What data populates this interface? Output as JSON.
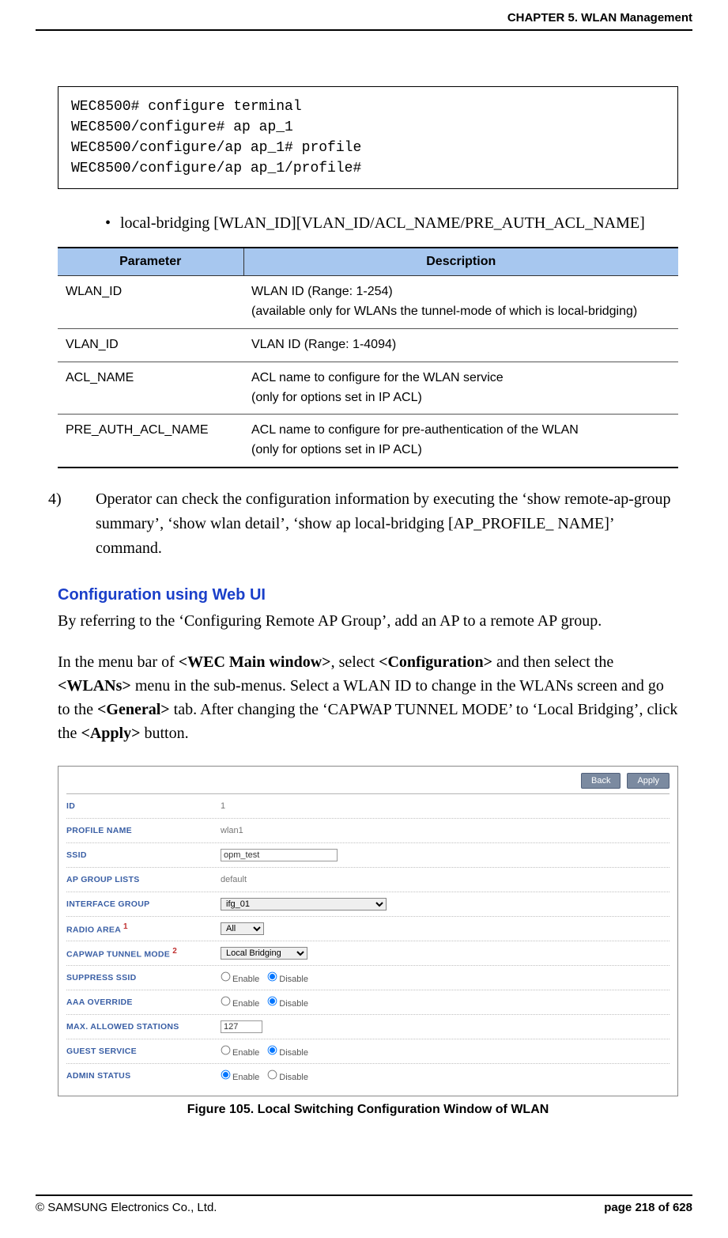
{
  "header": {
    "chapter": "CHAPTER 5. WLAN Management"
  },
  "code": {
    "l1": "WEC8500# configure terminal",
    "l2": "WEC8500/configure# ap ap_1",
    "l3": "WEC8500/configure/ap ap_1# profile",
    "l4": "WEC8500/configure/ap ap_1/profile#"
  },
  "bullet": {
    "marker": "•",
    "text": "local-bridging  [WLAN_ID][VLAN_ID/ACL_NAME/PRE_AUTH_ACL_NAME]"
  },
  "ptable": {
    "h1": "Parameter",
    "h2": "Description",
    "rows": [
      {
        "p": "WLAN_ID",
        "d": "WLAN ID (Range: 1-254)\n(available only for WLANs the tunnel-mode of which is local-bridging)"
      },
      {
        "p": "VLAN_ID",
        "d": "VLAN ID (Range: 1-4094)"
      },
      {
        "p": "ACL_NAME",
        "d": "ACL name to configure for the WLAN service\n(only for options set in IP ACL)"
      },
      {
        "p": "PRE_AUTH_ACL_NAME",
        "d": "ACL name to configure for pre-authentication of the WLAN\n(only for options set in IP ACL)"
      }
    ]
  },
  "step4": {
    "num": "4)",
    "text": "Operator can check the configuration information by executing the ‘show remote-ap-group summary’, ‘show wlan detail’, ‘show ap local-bridging [AP_PROFILE_ NAME]’ command."
  },
  "webui_heading": "Configuration using Web UI",
  "para1": "By referring to the ‘Configuring Remote AP Group’, add an AP to a remote AP group.",
  "para2_parts": {
    "a": "In the menu bar of ",
    "b": "<WEC Main window>",
    "c": ", select ",
    "d": "<Configuration>",
    "e": " and then select the ",
    "f": "<WLANs>",
    "g": " menu in the sub-menus. Select a WLAN ID to change in the WLANs screen and go to the ",
    "h": "<General>",
    "i": " tab. After changing the ‘CAPWAP TUNNEL MODE’ to ‘Local Bridging’, click the ",
    "j": "<Apply>",
    "k": " button."
  },
  "ui": {
    "buttons": {
      "back": "Back",
      "apply": "Apply"
    },
    "rows": {
      "id_label": "ID",
      "id_val": "1",
      "profile_label": "PROFILE NAME",
      "profile_val": "wlan1",
      "ssid_label": "SSID",
      "ssid_val": "opm_test",
      "apg_label": "AP GROUP LISTS",
      "apg_val": "default",
      "ifg_label": "INTERFACE GROUP",
      "ifg_val": "ifg_01",
      "radio_label": "RADIO AREA",
      "radio_sup": "1",
      "radio_val": "All",
      "capwap_label": "CAPWAP TUNNEL MODE",
      "capwap_sup": "2",
      "capwap_val": "Local Bridging",
      "suppress_label": "SUPPRESS SSID",
      "aaa_label": "AAA OVERRIDE",
      "max_label": "MAX. ALLOWED STATIONS",
      "max_val": "127",
      "guest_label": "GUEST SERVICE",
      "admin_label": "ADMIN STATUS",
      "enable": "Enable",
      "disable": "Disable"
    }
  },
  "figure_caption": "Figure 105. Local Switching Configuration Window of WLAN",
  "footer": {
    "left": "© SAMSUNG Electronics Co., Ltd.",
    "right": "page 218 of 628"
  }
}
